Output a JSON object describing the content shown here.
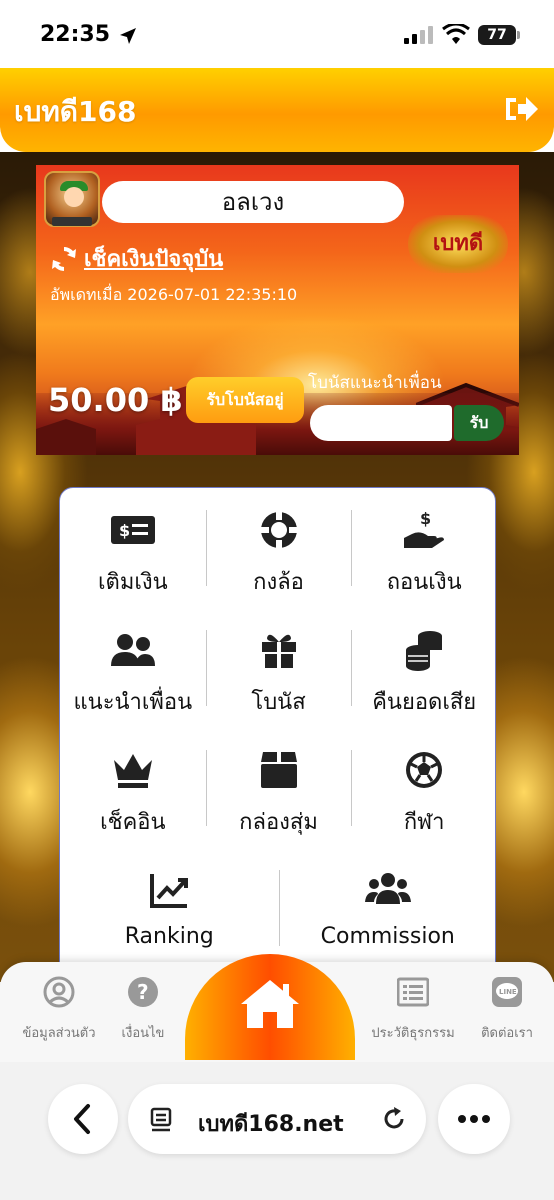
{
  "status_bar": {
    "time": "22:35",
    "battery": "77"
  },
  "header": {
    "title": "เบทดี168"
  },
  "banner": {
    "username": "อลเวง",
    "logo_text": "เบทดี",
    "check_balance_label": "เช็คเงินปัจจุบัน",
    "updated_label": "อัพเดทเมื่อ",
    "updated_time": "2026-07-01 22:35:10",
    "balance": "50.00 ฿",
    "bonus_button": "รับโบนัสอยู่",
    "referral_label": "โบนัสแนะนำเพื่อน",
    "referral_placeholder": "",
    "claim_button": "รับ"
  },
  "menu": {
    "items": [
      {
        "label": "เติมเงิน",
        "icon": "money-bill-icon"
      },
      {
        "label": "กงล้อ",
        "icon": "wheel-icon"
      },
      {
        "label": "ถอนเงิน",
        "icon": "hand-dollar-icon"
      },
      {
        "label": "แนะนำเพื่อน",
        "icon": "users-icon"
      },
      {
        "label": "โบนัส",
        "icon": "gift-icon"
      },
      {
        "label": "คืนยอดเสีย",
        "icon": "coins-icon"
      },
      {
        "label": "เช็คอิน",
        "icon": "crown-icon"
      },
      {
        "label": "กล่องสุ่ม",
        "icon": "box-icon"
      },
      {
        "label": "กีฬา",
        "icon": "soccer-ball-icon"
      },
      {
        "label": "Ranking",
        "icon": "chart-line-icon"
      },
      {
        "label": "Commission",
        "icon": "users-group-icon"
      }
    ]
  },
  "bottom_nav": {
    "items": [
      {
        "label": "ข้อมูลส่วนตัว",
        "icon": "user-circle-icon"
      },
      {
        "label": "เงื่อนไข",
        "icon": "question-circle-icon"
      },
      {
        "label": "",
        "icon": "home-icon"
      },
      {
        "label": "ประวัติธุรกรรม",
        "icon": "list-icon"
      },
      {
        "label": "ติดต่อเรา",
        "icon": "line-icon"
      }
    ]
  },
  "browser": {
    "url": "เบทดี168.net"
  },
  "colors": {
    "accent_yellow": "#ffc400",
    "accent_orange": "#ff8a00",
    "claim_green": "#1f6b2c",
    "card_border": "#6f79c8"
  }
}
